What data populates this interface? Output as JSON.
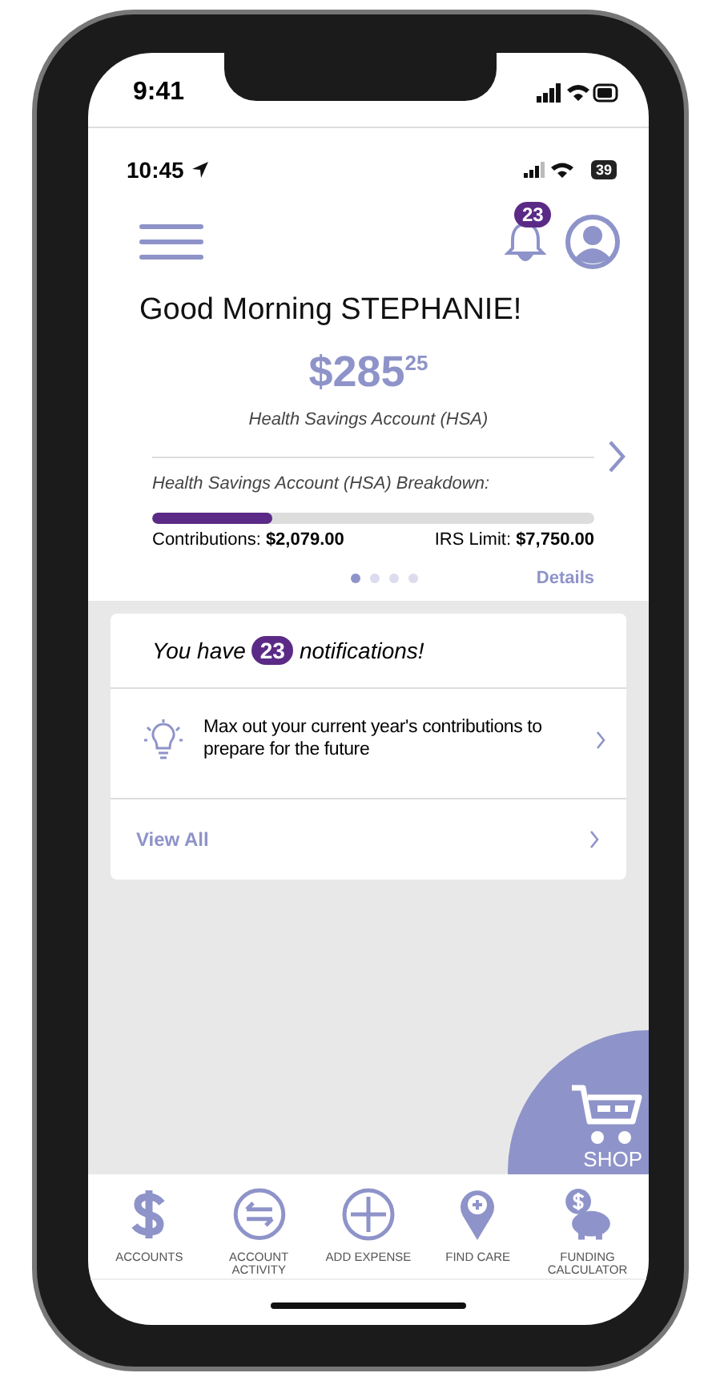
{
  "device_status": {
    "time": "9:41"
  },
  "app_status": {
    "time": "10:45",
    "battery": "39"
  },
  "header": {
    "notification_badge": "23"
  },
  "greeting": "Good Morning STEPHANIE!",
  "balance": {
    "amount": "$285$^{25}$",
    "label": "Health Savings Account (HSA)"
  },
  "breakdown": {
    "title": "Health Savings Account (HSA) Breakdown:",
    "level": 0.27,
    "contributions_label": "Contributions:",
    "contributions": "$2,079.00",
    "limit_label": "IRS Limit:",
    "limit": "$7,750.00"
  },
  "pager": [
    {
      "selected": true
    },
    {
      "selected": false
    },
    {
      "selected": false
    },
    {
      "selected": false
    }
  ],
  "details_link": "Details",
  "notifications": {
    "prefix": "You have",
    "count": "23",
    "suffix": "notifications!",
    "items": [
      {
        "text": "Max out your current year's contributions to prepare for the future"
      }
    ],
    "view_all": "View All"
  },
  "shop": "SHOP",
  "nav": [
    {
      "kind": "dollar",
      "label": "ACCOUNTS"
    },
    {
      "kind": "transfer",
      "label": "ACCOUNT ACTIVITY"
    },
    {
      "kind": "plus",
      "label": "ADD EXPENSE"
    },
    {
      "kind": "pin",
      "label": "FIND CARE"
    },
    {
      "kind": "piggy",
      "label": "FUNDING CALCULATOR"
    }
  ]
}
